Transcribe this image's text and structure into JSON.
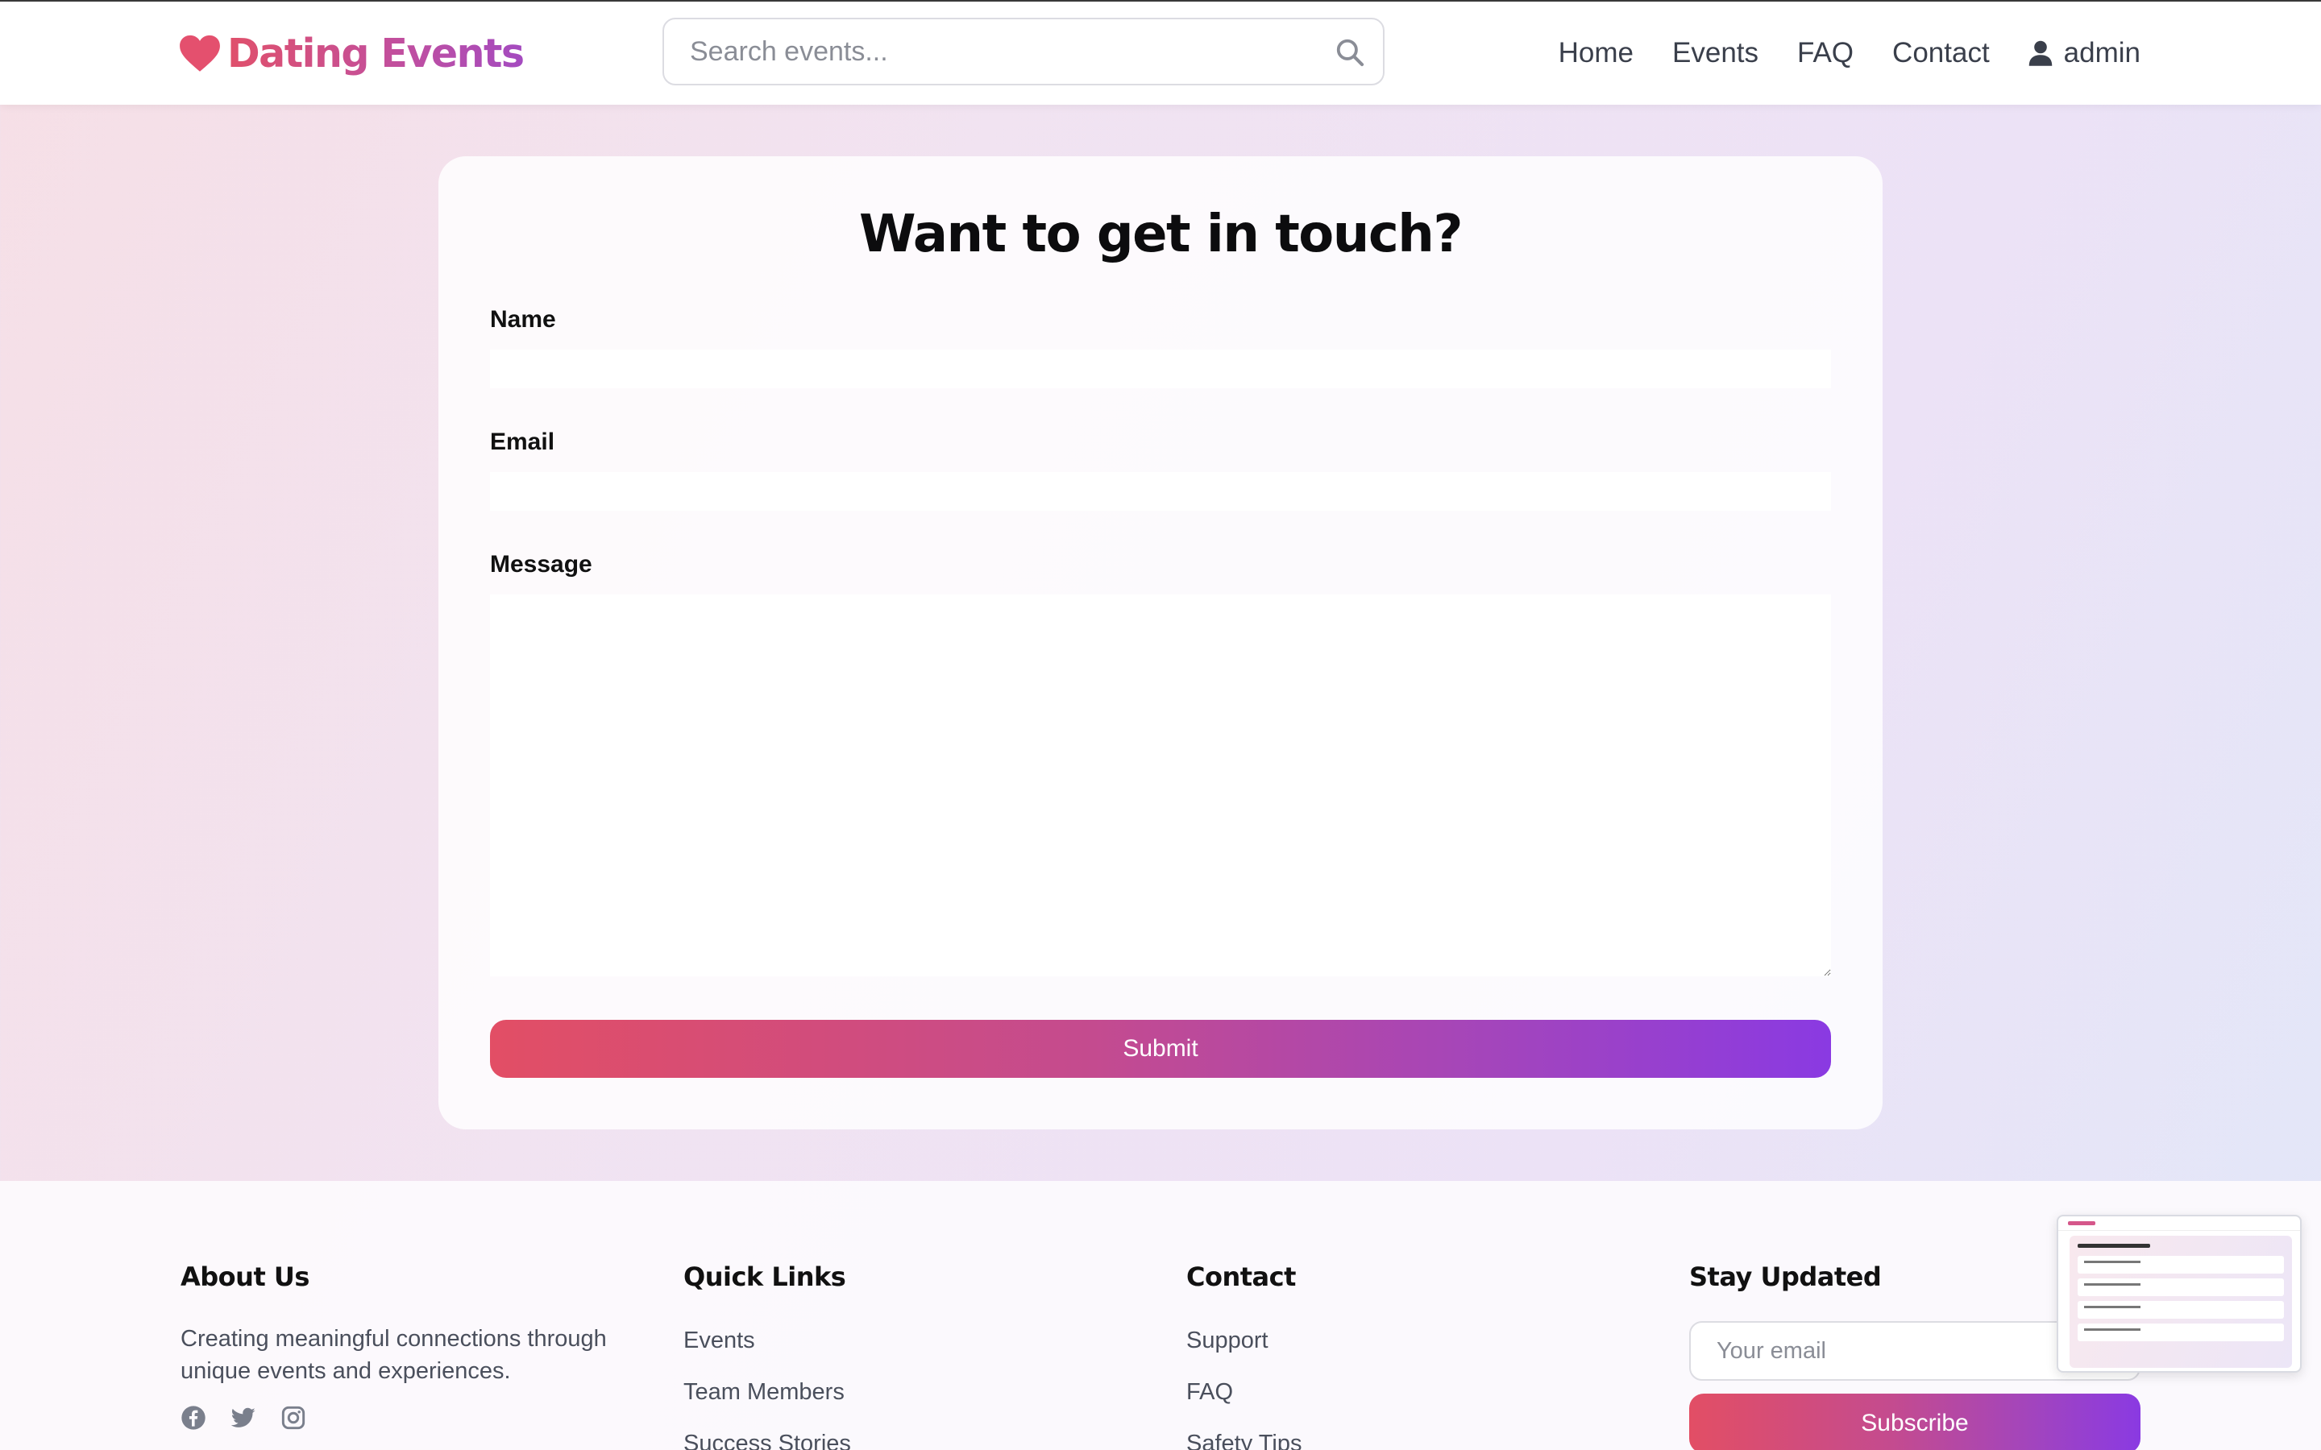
{
  "header": {
    "brand": "Dating Events",
    "search_placeholder": "Search events...",
    "nav": [
      "Home",
      "Events",
      "FAQ",
      "Contact"
    ],
    "user_name": "admin"
  },
  "contact_form": {
    "title": "Want to get in touch?",
    "name_label": "Name",
    "email_label": "Email",
    "message_label": "Message",
    "submit_label": "Submit"
  },
  "footer": {
    "about": {
      "heading": "About Us",
      "text": "Creating meaningful connections through unique events and experiences."
    },
    "quick_links": {
      "heading": "Quick Links",
      "items": [
        "Events",
        "Team Members",
        "Success Stories"
      ]
    },
    "contact": {
      "heading": "Contact",
      "items": [
        "Support",
        "FAQ",
        "Safety Tips"
      ]
    },
    "newsletter": {
      "heading": "Stay Updated",
      "email_placeholder": "Your email",
      "subscribe_label": "Subscribe"
    }
  },
  "icons": {
    "brand": "heart-icon",
    "search": "search-icon",
    "user": "user-icon",
    "social": [
      "facebook-icon",
      "twitter-icon",
      "instagram-icon"
    ]
  },
  "colors": {
    "brand_pink": "#e0506b",
    "brand_purple": "#8a3ae2"
  }
}
